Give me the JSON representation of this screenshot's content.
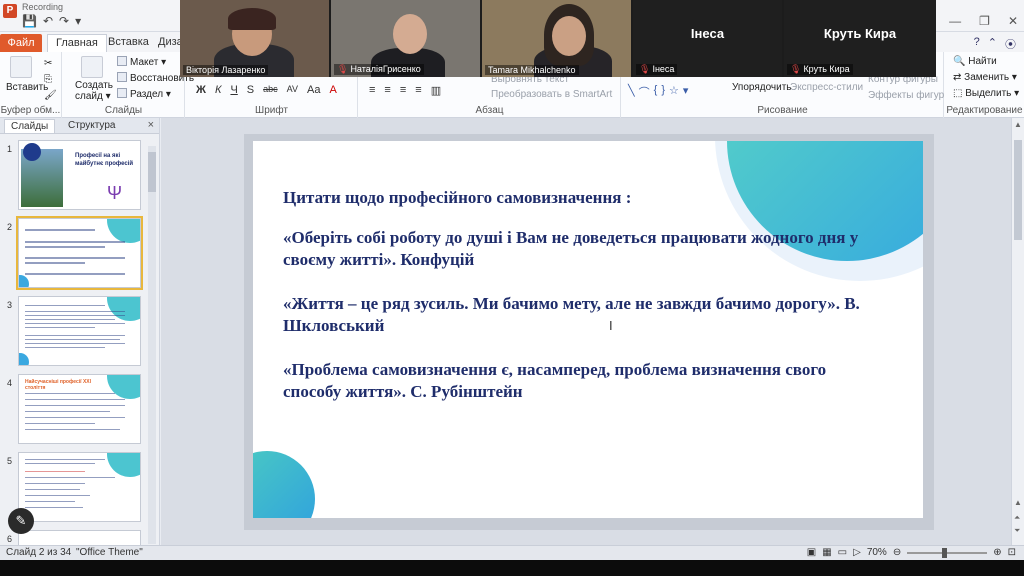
{
  "titlebar": {
    "app_icon": "P",
    "recording_label": "Recording",
    "window_controls": [
      "—",
      "❐",
      "✕"
    ]
  },
  "tabs": {
    "file": "Файл",
    "items": [
      "Главная",
      "Вставка",
      "Дизай"
    ],
    "right_icons": [
      "?",
      "⌃",
      "⦿"
    ]
  },
  "ribbon": {
    "clipboard": {
      "label": "Буфер обм...",
      "paste": "Вставить"
    },
    "slides": {
      "label": "Слайды",
      "create": "Создать слайд ▾",
      "layout": "Макет ▾",
      "restore": "Восстановить",
      "section": "Раздел ▾"
    },
    "font": {
      "label": "Шрифт",
      "format_buttons": [
        "Ж",
        "К",
        "Ч",
        "S",
        "abc",
        "AV",
        "Aa",
        "A"
      ]
    },
    "paragraph": {
      "label": "Абзац",
      "align_text": "Выровнять текст",
      "smartart": "Преобразовать в SmartArt"
    },
    "drawing": {
      "label": "Рисование",
      "arrange": "Упорядочить",
      "quick_styles": "Экспресс-стили",
      "shape_outline": "Контур фигуры",
      "shape_effects": "Эффекты фигур"
    },
    "editing": {
      "label": "Редактирование",
      "find": "Найти",
      "replace": "Заменить ▾",
      "select": "Выделить ▾"
    }
  },
  "video": {
    "tiles": [
      {
        "name": "Вікторія Лазаренко",
        "muted": false,
        "has_video": true
      },
      {
        "name": "НаталіяГрисенко",
        "muted": true,
        "has_video": true
      },
      {
        "name": "Tamara Mikhalchenko",
        "muted": false,
        "has_video": true
      },
      {
        "name": "Інеса",
        "muted": true,
        "has_video": false,
        "center_label": "Інеса"
      },
      {
        "name": "Круть Кира",
        "muted": true,
        "has_video": false,
        "center_label": "Круть Кира"
      }
    ]
  },
  "left_panel": {
    "tabs": [
      "Слайды",
      "Структура"
    ],
    "close": "×",
    "slides": [
      {
        "num": "1",
        "title_lines": [
          "Професії на які",
          "майбутнє професій"
        ]
      },
      {
        "num": "2",
        "selected": true
      },
      {
        "num": "3"
      },
      {
        "num": "4",
        "title_lines": [
          "Найсучасніші професії XXI століття"
        ]
      },
      {
        "num": "5"
      },
      {
        "num": "6"
      }
    ]
  },
  "slide": {
    "heading": "Цитати щодо професійного самовизначення :",
    "quotes": [
      "«Оберіть собі роботу до душі і Вам не доведеться працювати жодного дня у своєму житті». Конфуцій",
      "«Життя – це ряд зусиль. Ми бачимо мету, але не завжди бачимо дорогу».  В. Шкловський",
      "«Проблема самовизначення є, насамперед, проблема визначення свого способу життя».  С. Рубінштейн"
    ]
  },
  "statusbar": {
    "slide_info": "Слайд 2 из 34",
    "theme": "\"Office Theme\"",
    "zoom": "70%",
    "zoom_minus": "⊖",
    "zoom_plus": "⊕",
    "zoom_fraction": 0.46
  },
  "colors": {
    "slide_text": "#1f2d6b",
    "accent_teal": "#4ccdc0",
    "accent_blue": "#35a8e0",
    "file_tab": "#e05a2b"
  }
}
